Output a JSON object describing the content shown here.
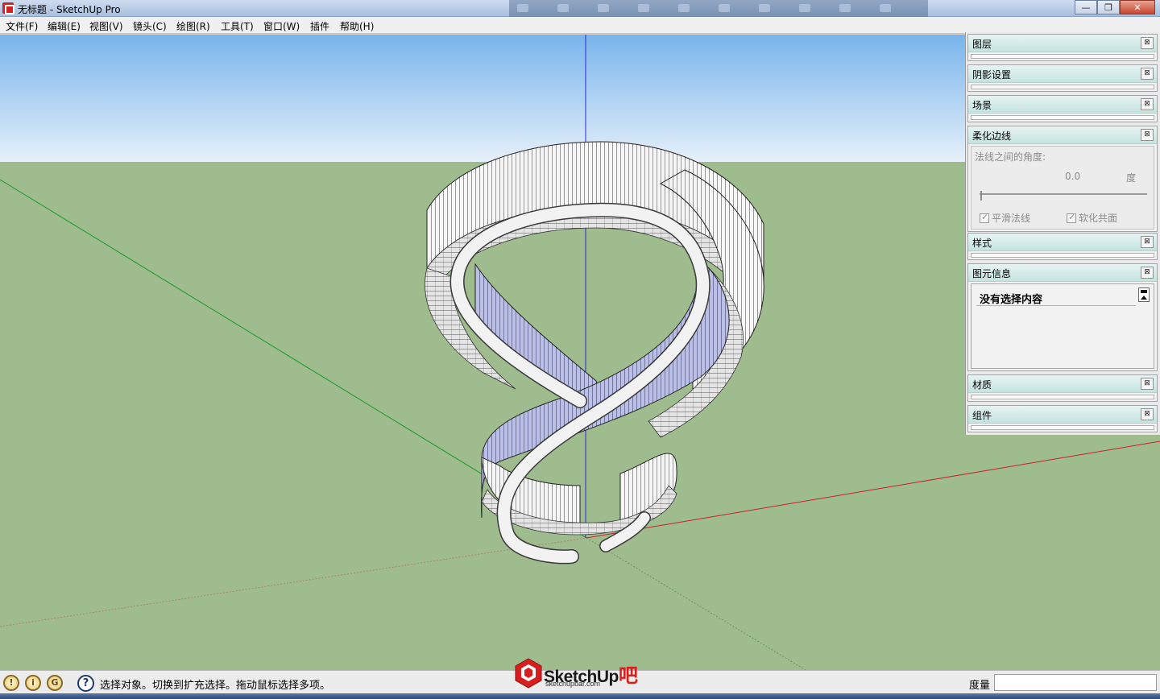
{
  "window": {
    "title": "无标题 - SketchUp Pro",
    "controls": {
      "minimize": "—",
      "maximize": "❐",
      "close": "✕"
    }
  },
  "menu": [
    "文件(F)",
    "编辑(E)",
    "视图(V)",
    "镜头(C)",
    "绘图(R)",
    "工具(T)",
    "窗口(W)",
    "插件",
    "帮助(H)"
  ],
  "tray": {
    "close_glyph": "⊠",
    "panels": {
      "layers": "图层",
      "shadows": "阴影设置",
      "scenes": "场景",
      "soften": {
        "title": "柔化边线",
        "angle_label": "法线之间的角度:",
        "angle_value": "0.0",
        "angle_unit": "度",
        "smooth_normals": "平滑法线",
        "soften_coplanar": "软化共面",
        "smooth_normals_checked": true,
        "soften_coplanar_checked": true
      },
      "styles": "样式",
      "entity_info": {
        "title": "图元信息",
        "content": "没有选择内容"
      },
      "materials": "材质",
      "components": "组件"
    }
  },
  "statusbar": {
    "help_glyph": "?",
    "message": "选择对象。切换到扩充选择。拖动鼠标选择多项。",
    "measure_label": "度量",
    "measure_value": ""
  },
  "watermark": {
    "name": "SketchUp",
    "suffix": "吧",
    "url": "sketchupbar.com"
  },
  "colors": {
    "sky_top": "#78b4ec",
    "sky_bottom": "#e6f0fa",
    "ground": "#9ebc8e",
    "rail_blue": "#9aa2d6",
    "handrail": "#f2f2f2"
  }
}
